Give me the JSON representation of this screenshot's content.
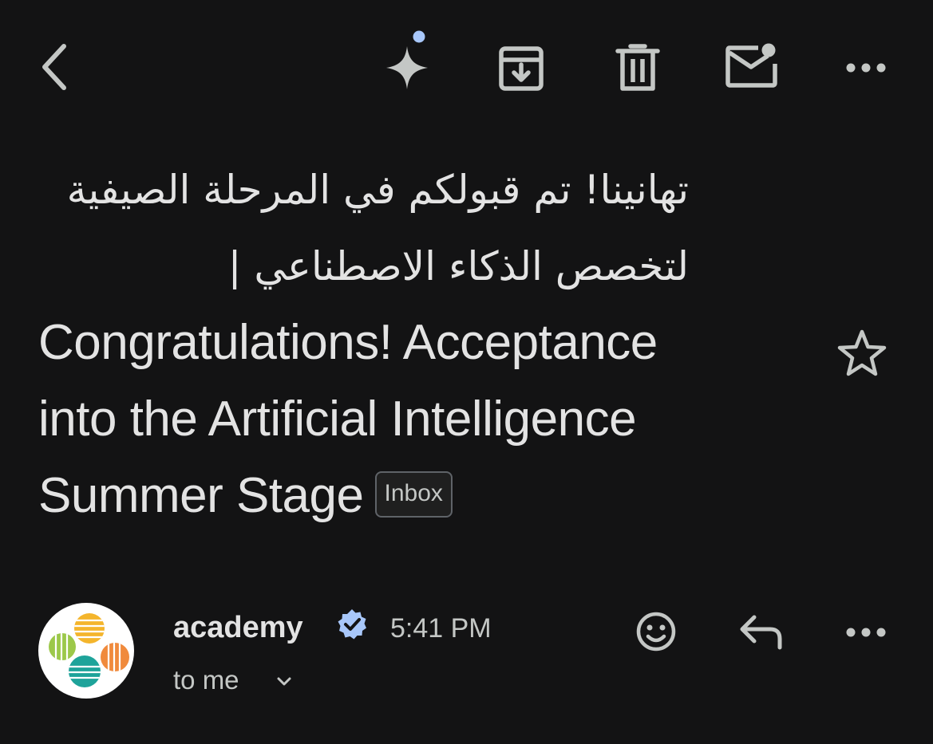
{
  "toolbar": {
    "back": "back-icon",
    "gemini": "sparkle-icon",
    "archive": "archive-icon",
    "delete": "trash-icon",
    "mark_unread": "mark-unread-icon",
    "more": "more-horizontal-icon"
  },
  "email": {
    "subject_ar_line1": "تهانينا! تم قبولكم في المرحلة الصيفية",
    "subject_ar_line2": "لتخصص الذكاء الاصطناعي |",
    "subject_en_line1": "Congratulations! Acceptance",
    "subject_en_line2": "into the Artificial Intelligence",
    "subject_en_line3": "Summer Stage",
    "label": "Inbox",
    "starred": false
  },
  "sender": {
    "name": "academy",
    "verified": true,
    "time": "5:41 PM",
    "to_text": "to me"
  },
  "actions": {
    "react": "emoji-icon",
    "reply": "reply-icon",
    "more": "more-horizontal-icon"
  },
  "colors": {
    "background": "#131314",
    "text": "#e3e3e3",
    "icon": "#c4c7c5",
    "accent_dot": "#a8c7fa",
    "verified_badge": "#a8c7fa"
  }
}
